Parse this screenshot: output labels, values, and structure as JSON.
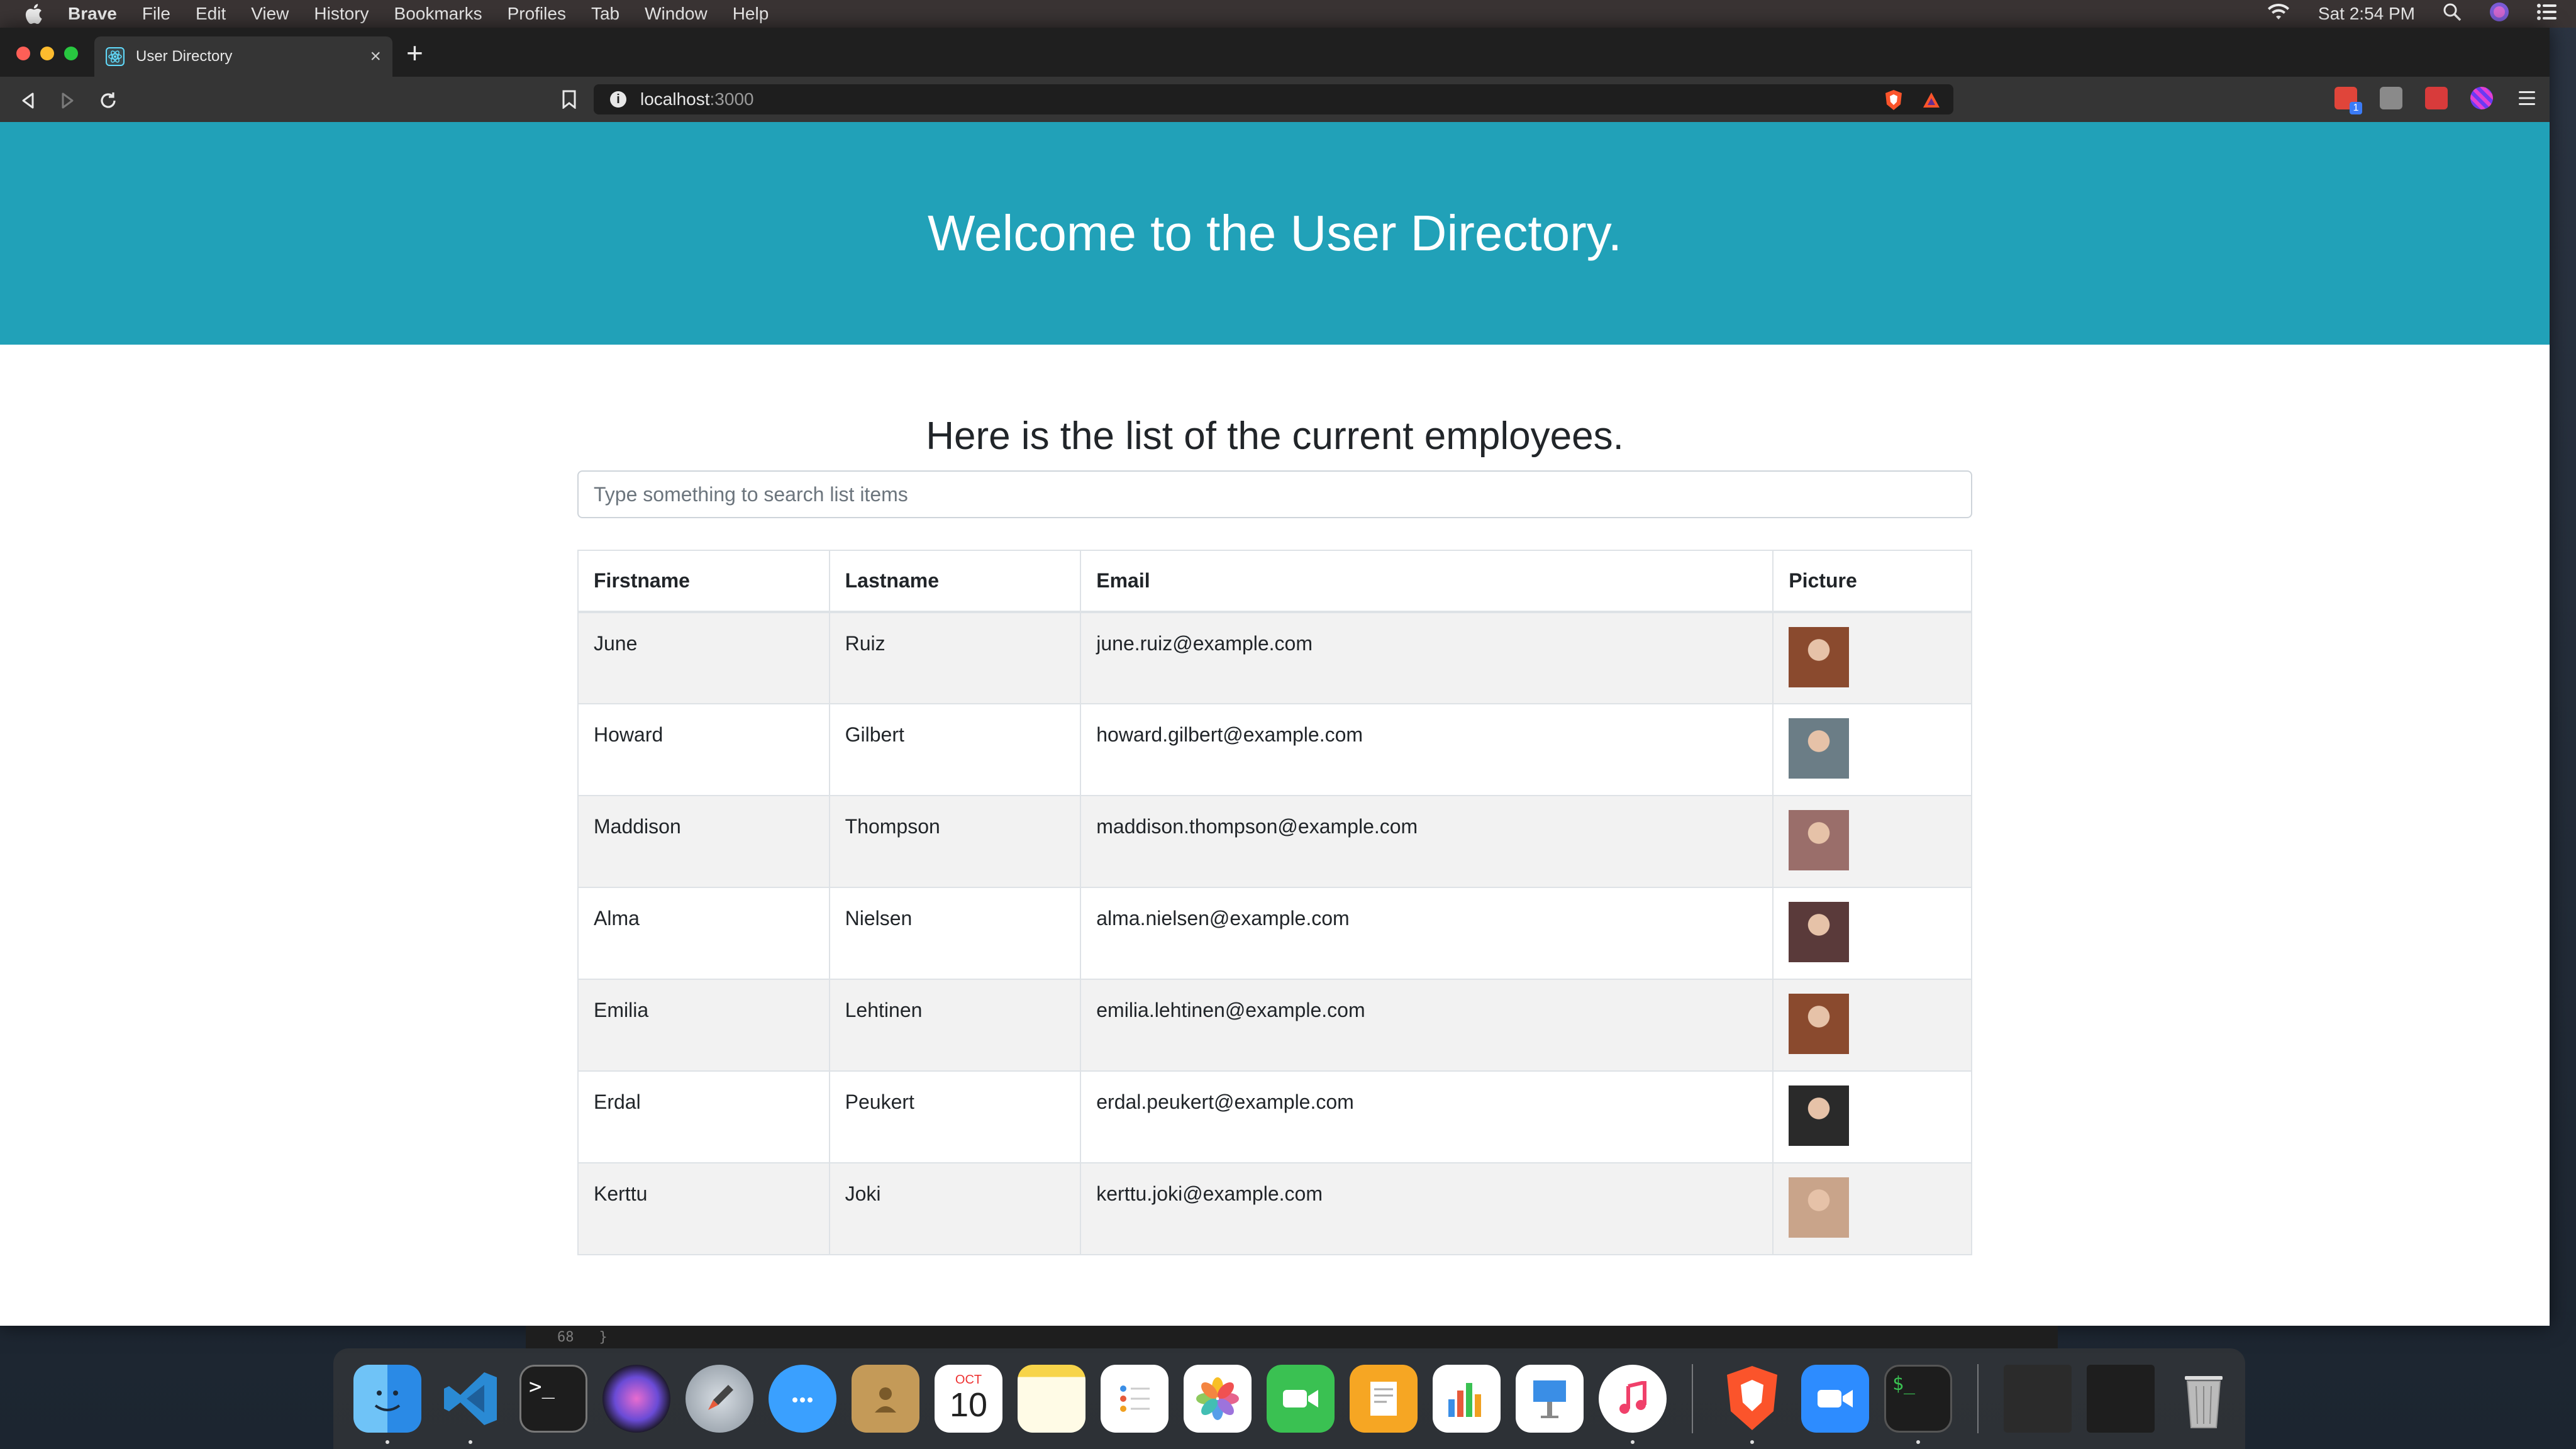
{
  "menubar": {
    "app_name": "Brave",
    "items": [
      "File",
      "Edit",
      "View",
      "History",
      "Bookmarks",
      "Profiles",
      "Tab",
      "Window",
      "Help"
    ],
    "clock": "Sat 2:54 PM"
  },
  "browser": {
    "tab_title": "User Directory",
    "url_host": "localhost",
    "url_port": ":3000"
  },
  "page": {
    "heading": "Welcome to the User Directory.",
    "subtitle": "Here is the list of the current employees.",
    "search_placeholder": "Type something to search list items",
    "table": {
      "headers": [
        "Firstname",
        "Lastname",
        "Email",
        "Picture"
      ],
      "rows": [
        {
          "first": "June",
          "last": "Ruiz",
          "email": "june.ruiz@example.com",
          "avatar_color": "#8a4a2e"
        },
        {
          "first": "Howard",
          "last": "Gilbert",
          "email": "howard.gilbert@example.com",
          "avatar_color": "#6b7d86"
        },
        {
          "first": "Maddison",
          "last": "Thompson",
          "email": "maddison.thompson@example.com",
          "avatar_color": "#9a6e6a"
        },
        {
          "first": "Alma",
          "last": "Nielsen",
          "email": "alma.nielsen@example.com",
          "avatar_color": "#5a3a3a"
        },
        {
          "first": "Emilia",
          "last": "Lehtinen",
          "email": "emilia.lehtinen@example.com",
          "avatar_color": "#8a4a2e"
        },
        {
          "first": "Erdal",
          "last": "Peukert",
          "email": "erdal.peukert@example.com",
          "avatar_color": "#2a2a2a"
        },
        {
          "first": "Kerttu",
          "last": "Joki",
          "email": "kerttu.joki@example.com",
          "avatar_color": "#c9a48a"
        }
      ]
    }
  },
  "editor_sliver": {
    "line_number": "68",
    "code": "}"
  },
  "dock": {
    "calendar_month": "OCT",
    "calendar_day": "10",
    "apps": [
      "finder-icon",
      "vscode-icon",
      "terminal-icon",
      "siri-icon",
      "launchpad-icon",
      "messages-icon",
      "contacts-icon",
      "calendar-icon",
      "notes-icon",
      "reminders-icon",
      "photos-icon",
      "facetime-icon",
      "pages-icon",
      "numbers-icon",
      "keynote-icon",
      "music-icon",
      "brave-icon",
      "zoom-icon",
      "terminal-window-icon",
      "trash-icon"
    ]
  },
  "colors": {
    "jumbotron": "#21a1b8",
    "stripe": "#f2f2f2"
  }
}
